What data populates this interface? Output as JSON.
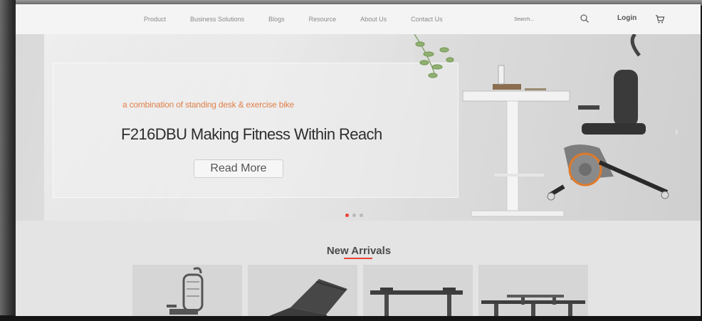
{
  "nav": {
    "links": [
      "Product",
      "Business Solutions",
      "Blogs",
      "Resource",
      "About Us",
      "Contact Us"
    ],
    "search_placeholder": "Search...",
    "login_label": "Login"
  },
  "hero": {
    "subtitle": "a combination of standing desk & exercise bike",
    "title": "F216DBU Making Fitness Within Reach",
    "read_more_label": "Read More",
    "slide_count": 3,
    "active_slide": 1,
    "next_arrow": "›"
  },
  "arrivals": {
    "title": "New Arrivals",
    "products": [
      "office-chair",
      "recliner-chair",
      "standing-desk-frame",
      "dual-desk-frame"
    ]
  },
  "colors": {
    "accent": "#e8443a",
    "subtitle_orange": "#e0804a"
  }
}
